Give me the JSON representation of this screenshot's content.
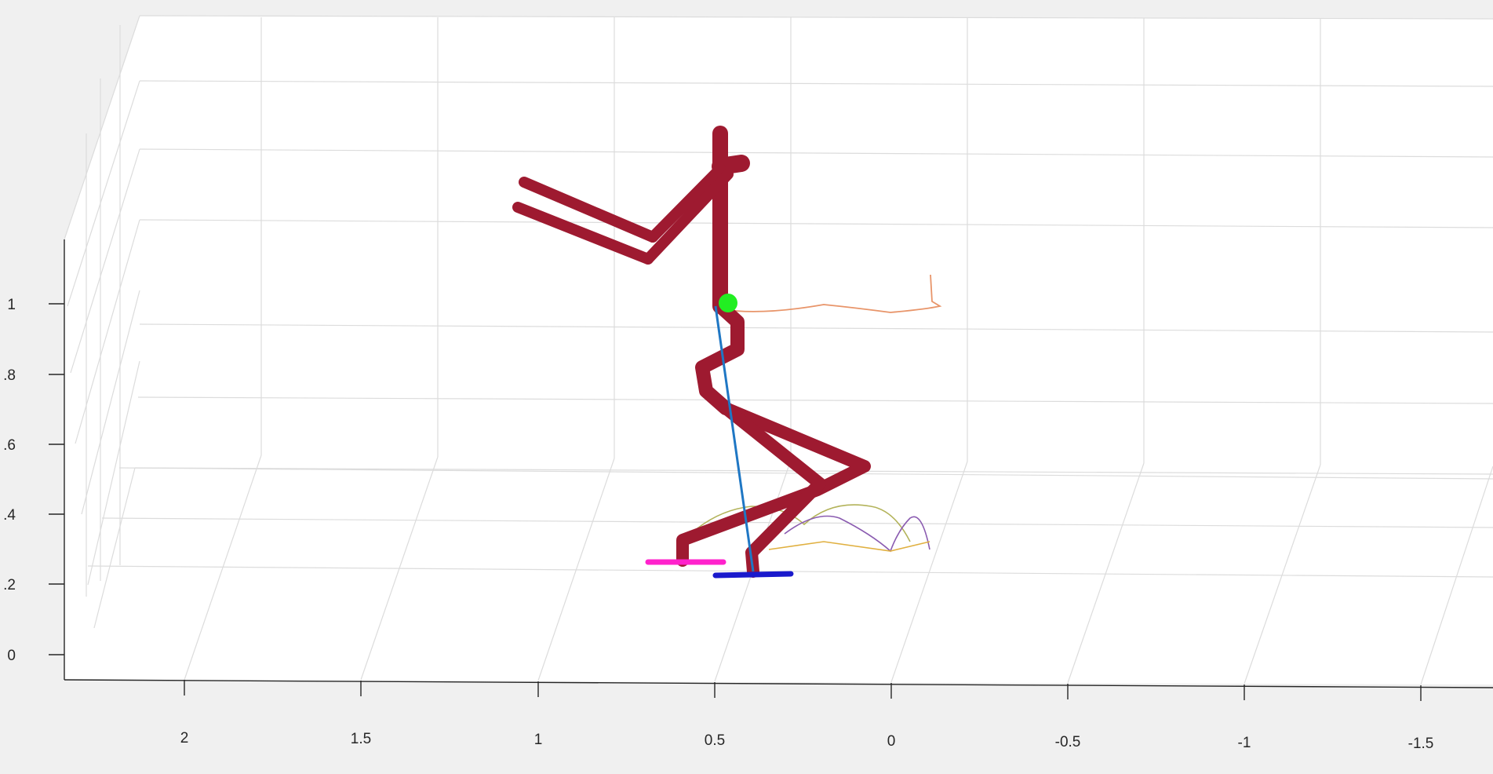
{
  "chart_data": {
    "type": "line",
    "title": "",
    "xlabel": "",
    "ylabel": "",
    "zlabel": "",
    "grid": true,
    "x_ticks": [
      "2",
      "1.5",
      "1",
      "0.5",
      "0",
      "-0.5",
      "-1",
      "-1.5"
    ],
    "z_ticks": [
      "0",
      ".2",
      ".4",
      ".6",
      ".8",
      "1"
    ],
    "colors": {
      "body": "#9e1a30",
      "center_of_mass_marker": "#22ee22",
      "support_line": "#1f77c4",
      "com_trajectory": "#e8956a",
      "left_foot": "#ff22cc",
      "right_foot": "#1a1acc",
      "swing_trajectory_1": "#b3b35a",
      "swing_trajectory_2": "#8a5bb0",
      "swing_trajectory_3": "#e0b040"
    }
  }
}
